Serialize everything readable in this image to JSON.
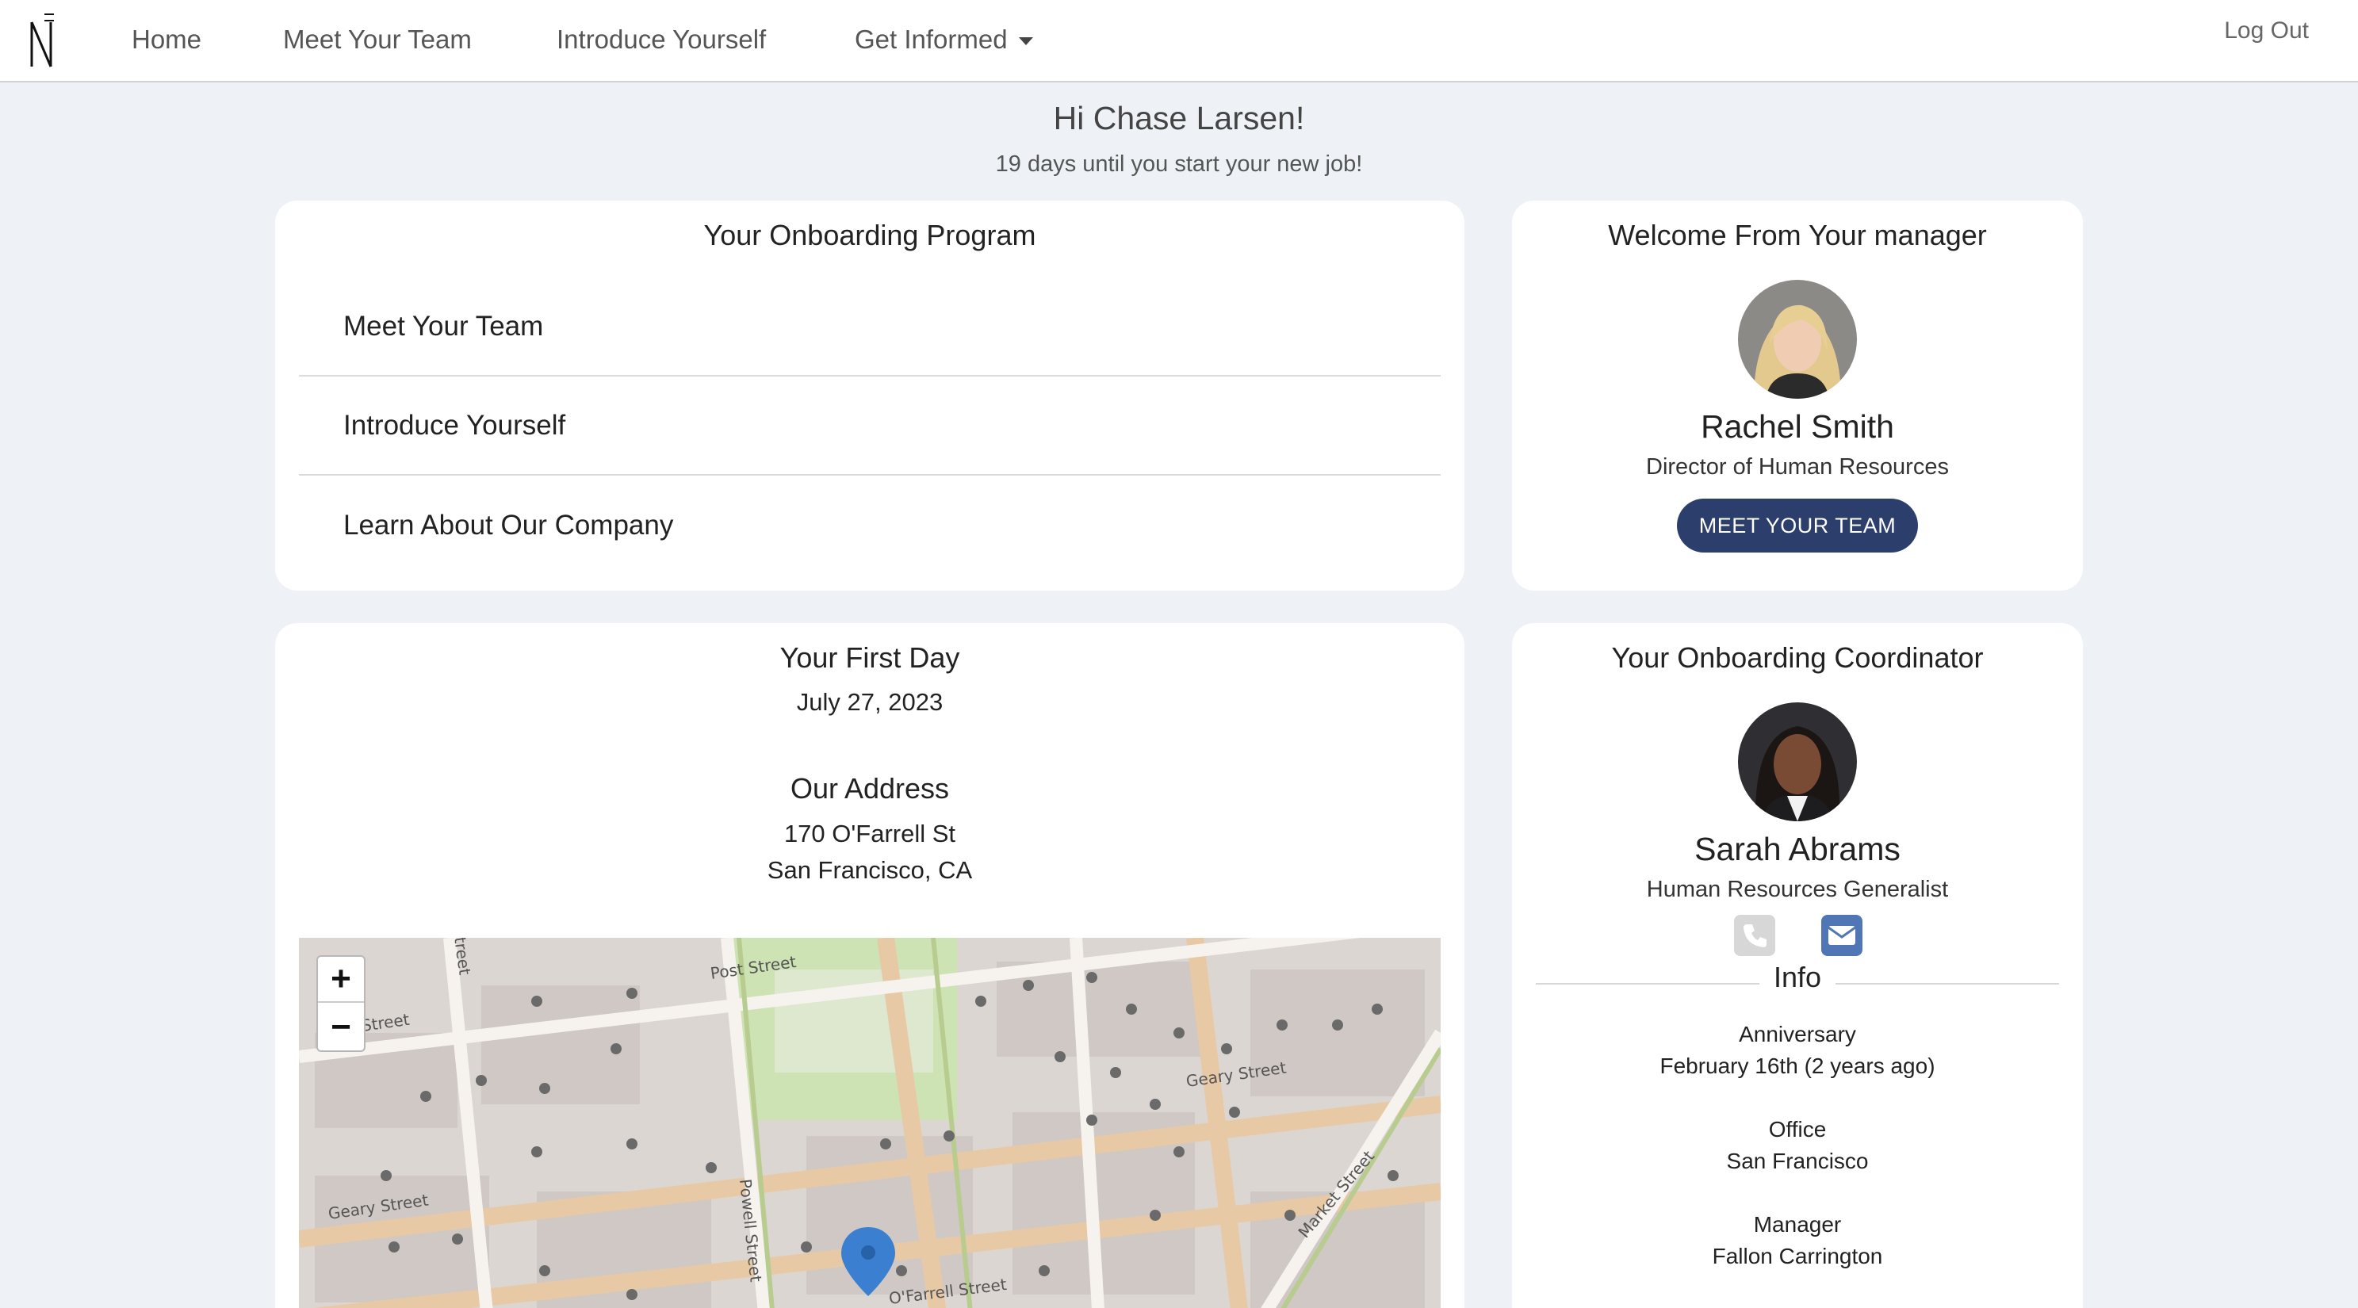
{
  "nav": {
    "items": [
      {
        "label": "Home"
      },
      {
        "label": "Meet Your Team"
      },
      {
        "label": "Introduce Yourself"
      },
      {
        "label": "Get Informed"
      }
    ],
    "logout": "Log Out"
  },
  "greeting": {
    "title": "Hi Chase Larsen!",
    "subtitle": "19 days until you start your new job!"
  },
  "onboarding": {
    "title": "Your Onboarding Program",
    "items": [
      "Meet Your Team",
      "Introduce Yourself",
      "Learn About Our Company"
    ]
  },
  "manager": {
    "title": "Welcome From Your manager",
    "name": "Rachel Smith",
    "role": "Director of Human Resources",
    "button": "MEET YOUR TEAM"
  },
  "first_day": {
    "title": "Your First Day",
    "date": "July 27, 2023",
    "address_title": "Our Address",
    "address_line1": "170 O'Farrell St",
    "address_line2": "San Francisco, CA",
    "map_labels": {
      "post_street": "Post Street",
      "geary_street_1": "Geary Street",
      "geary_street_2": "Geary Street",
      "street_left": "Street",
      "street_top": "treet",
      "powell_street": "Powell Street",
      "ofarrell_street": "O'Farrell Street",
      "market_street": "Market Street"
    },
    "zoom_in": "+",
    "zoom_out": "−"
  },
  "coordinator": {
    "title": "Your Onboarding Coordinator",
    "name": "Sarah Abrams",
    "role": "Human Resources Generalist",
    "info_label": "Info",
    "anniversary_label": "Anniversary",
    "anniversary_value": "February 16th (2 years ago)",
    "office_label": "Office",
    "office_value": "San Francisco",
    "manager_label": "Manager",
    "manager_value": "Fallon Carrington"
  },
  "colors": {
    "primary_button": "#2c3e6b",
    "mail_icon": "#5176b6",
    "map_pin": "#3b7fd1"
  }
}
